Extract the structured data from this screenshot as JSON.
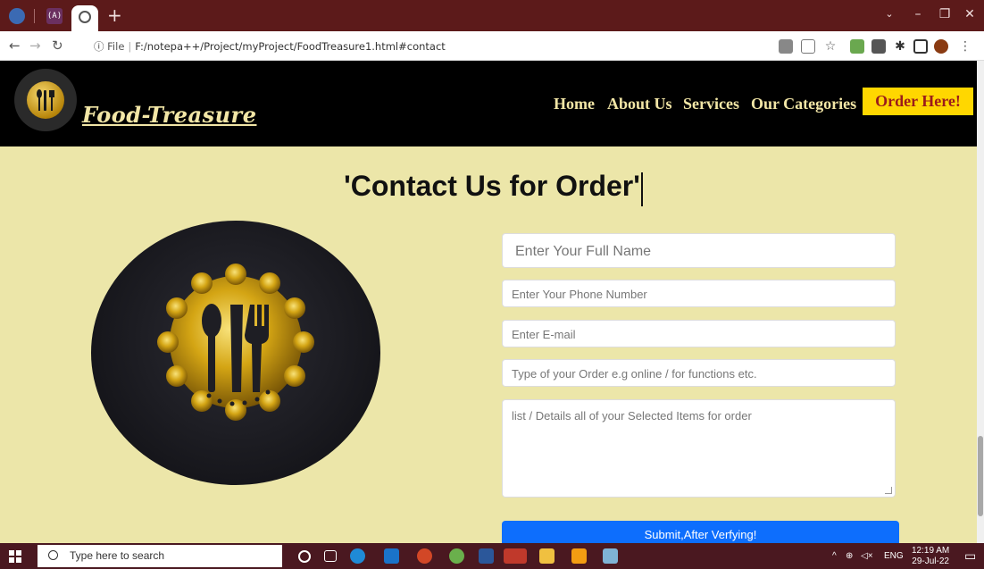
{
  "browser": {
    "url_label": "File",
    "url": "F:/notepa++/Project/myProject/FoodTreasure1.html#contact",
    "tab_new": "+",
    "tab_icon_text": "(A)"
  },
  "site": {
    "brand": "Food-Treasure",
    "nav": [
      "Home",
      "About Us",
      "Services",
      "Our Categories"
    ],
    "order_button": "Order Here!"
  },
  "contact": {
    "title": "'Contact Us for Order'",
    "placeholders": {
      "name": "Enter Your Full Name",
      "phone": "Enter Your Phone Number",
      "email": "Enter E-mail",
      "order_type": "Type of your Order e.g online / for functions etc.",
      "details": "list / Details all of your Selected Items for order"
    },
    "submit": "Submit,After Verfying!"
  },
  "taskbar": {
    "search_placeholder": "Type here to search",
    "language": "ENG",
    "time": "12:19 AM",
    "date": "29-Jul-22"
  },
  "colors": {
    "page_bg": "#ece6a9",
    "header_bg": "#000000",
    "nav_text": "#f2e6a6",
    "order_btn_bg": "#ffd700",
    "submit_bg": "#0d6efd",
    "tabbar_bg": "#5c1a1a"
  }
}
